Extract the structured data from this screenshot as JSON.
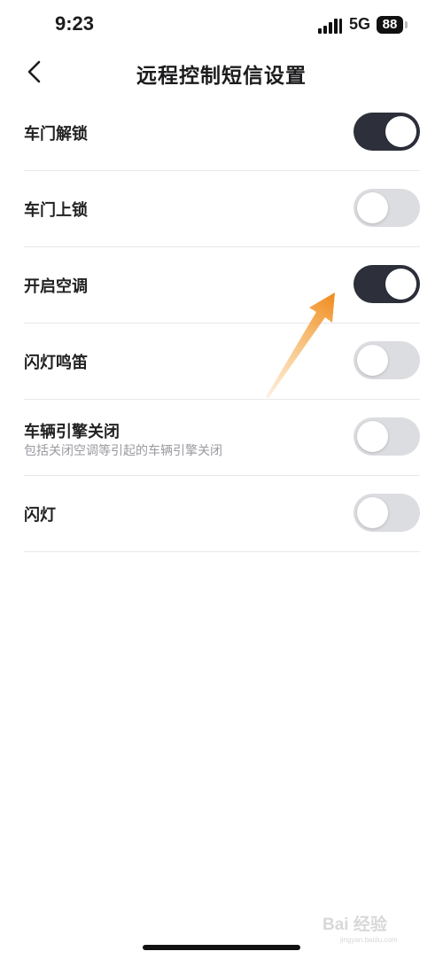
{
  "status_bar": {
    "time": "9:23",
    "network": "5G",
    "battery": "88"
  },
  "nav": {
    "title": "远程控制短信设置",
    "back_icon": "chevron-left-icon"
  },
  "settings": [
    {
      "label": "车门解锁",
      "sub": "",
      "on": true
    },
    {
      "label": "车门上锁",
      "sub": "",
      "on": false
    },
    {
      "label": "开启空调",
      "sub": "",
      "on": true
    },
    {
      "label": "闪灯鸣笛",
      "sub": "",
      "on": false
    },
    {
      "label": "车辆引擎关闭",
      "sub": "包括关闭空调等引起的车辆引擎关闭",
      "on": false
    },
    {
      "label": "闪灯",
      "sub": "",
      "on": false
    }
  ],
  "colors": {
    "toggle_on": "#2d2f3a",
    "toggle_off": "#dcdde0",
    "annotation_arrow": "#f08a1c"
  },
  "watermark": {
    "text": "Bai 经验",
    "sub": "jingyan.baidu.com"
  }
}
